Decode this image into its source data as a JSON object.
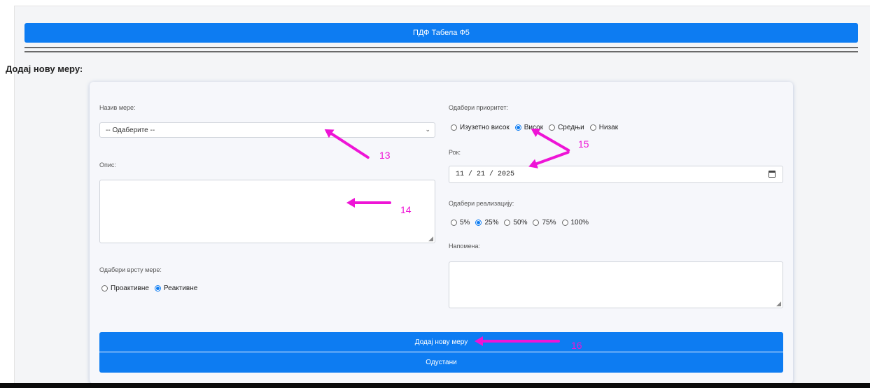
{
  "header": {
    "pdf_button_label": "ПДФ Табела Ф5"
  },
  "section_title": "Додај нову меру:",
  "form": {
    "measure_name": {
      "label": "Назив мере:",
      "selected": "-- Одаберите --"
    },
    "description": {
      "label": "Опис:",
      "value": ""
    },
    "measure_type": {
      "label": "Одабери врсту мере:",
      "options": [
        "Проактивне",
        "Реактивне"
      ],
      "selected": "Реактивне"
    },
    "priority": {
      "label": "Одабери приоритет:",
      "options": [
        "Изузетно висок",
        "Висок",
        "Средњи",
        "Низак"
      ],
      "selected": "Висок"
    },
    "deadline": {
      "label": "Рок:",
      "value": "11 / 21 / 2025"
    },
    "realization": {
      "label": "Одабери реализацију:",
      "options": [
        "5%",
        "25%",
        "50%",
        "75%",
        "100%"
      ],
      "selected": "25%"
    },
    "note": {
      "label": "Напомена:",
      "value": ""
    },
    "add_button_label": "Додај нову меру",
    "cancel_button_label": "Одустани"
  },
  "annotations": {
    "color": "#ee14d6",
    "labels": [
      "13",
      "14",
      "15",
      "16"
    ]
  },
  "colors": {
    "primary": "#0d7cf2",
    "annotation": "#ee14d6"
  }
}
